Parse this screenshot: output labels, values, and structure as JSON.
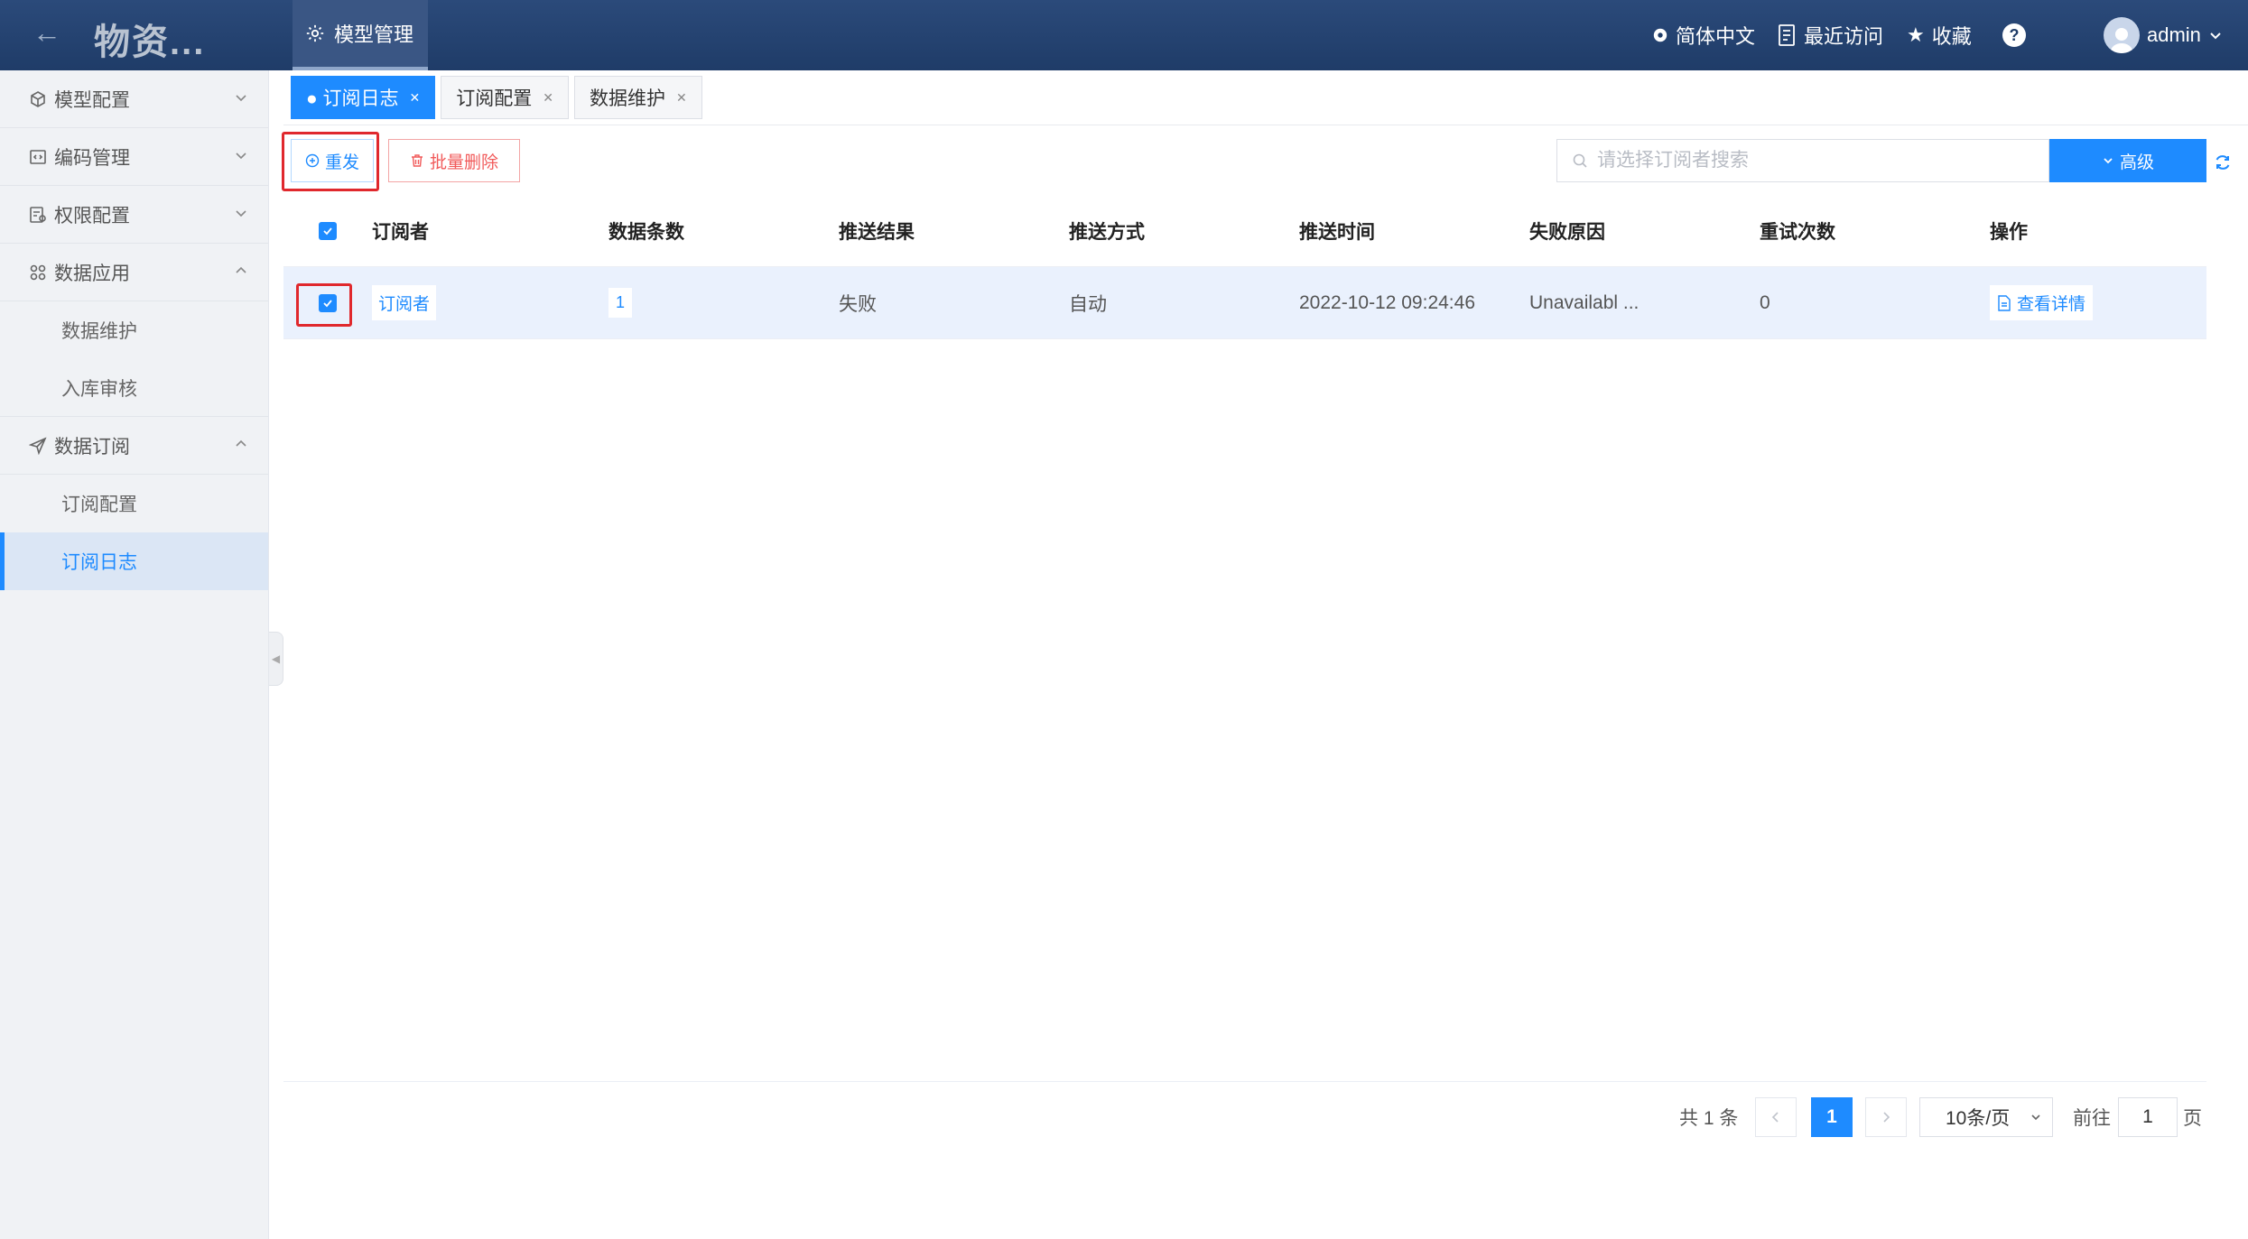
{
  "header": {
    "app_title": "物资...",
    "module_tab": "模型管理",
    "language": "简体中文",
    "recent": "最近访问",
    "favorites": "收藏",
    "help": "?",
    "user": "admin"
  },
  "sidebar": {
    "groups": [
      {
        "label": "模型配置",
        "icon": "cube-icon",
        "expanded": false
      },
      {
        "label": "编码管理",
        "icon": "code-icon",
        "expanded": false
      },
      {
        "label": "权限配置",
        "icon": "permission-icon",
        "expanded": false
      },
      {
        "label": "数据应用",
        "icon": "apps-icon",
        "expanded": true,
        "items": [
          "数据维护",
          "入库审核"
        ]
      },
      {
        "label": "数据订阅",
        "icon": "send-icon",
        "expanded": true,
        "items": [
          "订阅配置",
          "订阅日志"
        ]
      }
    ],
    "active_item": "订阅日志"
  },
  "tabs": [
    {
      "label": "订阅日志",
      "active": true
    },
    {
      "label": "订阅配置",
      "active": false
    },
    {
      "label": "数据维护",
      "active": false
    }
  ],
  "toolbar": {
    "resend_label": "重发",
    "batch_delete_label": "批量删除",
    "search_placeholder": "请选择订阅者搜索",
    "advanced_label": "高级"
  },
  "table": {
    "columns": [
      "订阅者",
      "数据条数",
      "推送结果",
      "推送方式",
      "推送时间",
      "失败原因",
      "重试次数",
      "操作"
    ],
    "rows": [
      {
        "checked": true,
        "subscriber": "订阅者",
        "count": "1",
        "result": "失败",
        "mode": "自动",
        "time": "2022-10-12 09:24:46",
        "reason": "Unavailabl ...",
        "retries": "0",
        "action": "查看详情"
      }
    ]
  },
  "pagination": {
    "total_text": "共 1 条",
    "current_page": "1",
    "page_size": "10条/页",
    "goto_label": "前往",
    "goto_value": "1",
    "page_unit": "页"
  },
  "colors": {
    "header_bg": "#1f3c68",
    "primary": "#1e8bff",
    "danger": "#f15a5a",
    "highlight_box": "#e0282d",
    "sidebar_bg": "#f0f2f5"
  }
}
